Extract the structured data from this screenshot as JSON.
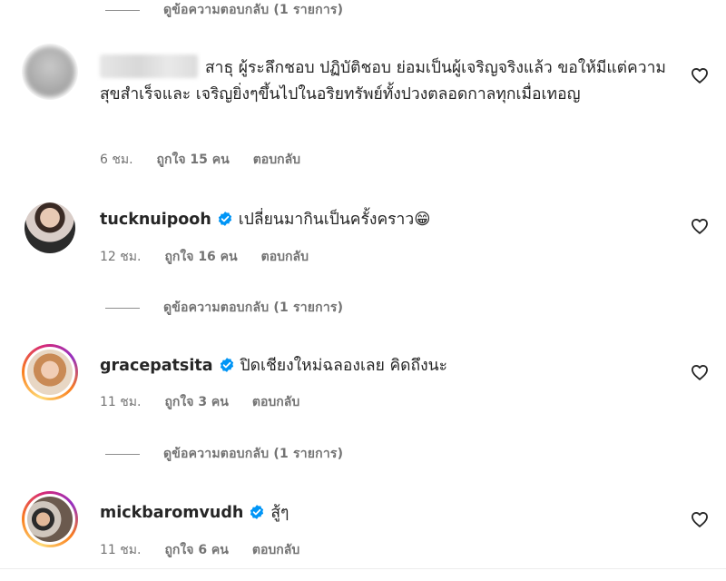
{
  "view_replies_label": "ดูข้อความตอบกลับ (1 รายการ)",
  "comments": [
    {
      "username": "",
      "text": "สาธุ ผู้ระลึกชอบ ปฏิบัติชอบ ย่อมเป็นผู้เจริญจริงแล้ว ขอให้มีแต่ความสุขสำเร็จและ เจริญยิ่งๆขึ้นไปในอริยทรัพย์ทั้งปวงตลอดกาลทุกเมื่อเทอญ",
      "time": "6 ชม.",
      "likes": "ถูกใจ 15 คน",
      "reply": "ตอบกลับ"
    },
    {
      "username": "tucknuipooh",
      "text": "เปลี่ยนมากินเป็นครั้งคราว😁",
      "time": "12 ชม.",
      "likes": "ถูกใจ 16 คน",
      "reply": "ตอบกลับ"
    },
    {
      "username": "gracepatsita",
      "text": "ปิดเชียงใหม่ฉลองเลย คิดถึงนะ",
      "time": "11 ชม.",
      "likes": "ถูกใจ 3 คน",
      "reply": "ตอบกลับ"
    },
    {
      "username": "mickbaromvudh",
      "text": "สู้ๆ",
      "time": "11 ชม.",
      "likes": "ถูกใจ 6 คน",
      "reply": "ตอบกลับ"
    }
  ],
  "icons": {
    "like": "heart-outline-icon",
    "verified": "verified-badge-icon"
  },
  "colors": {
    "verified": "#0095f6",
    "secondary_text": "#737373",
    "primary_text": "#262626"
  }
}
